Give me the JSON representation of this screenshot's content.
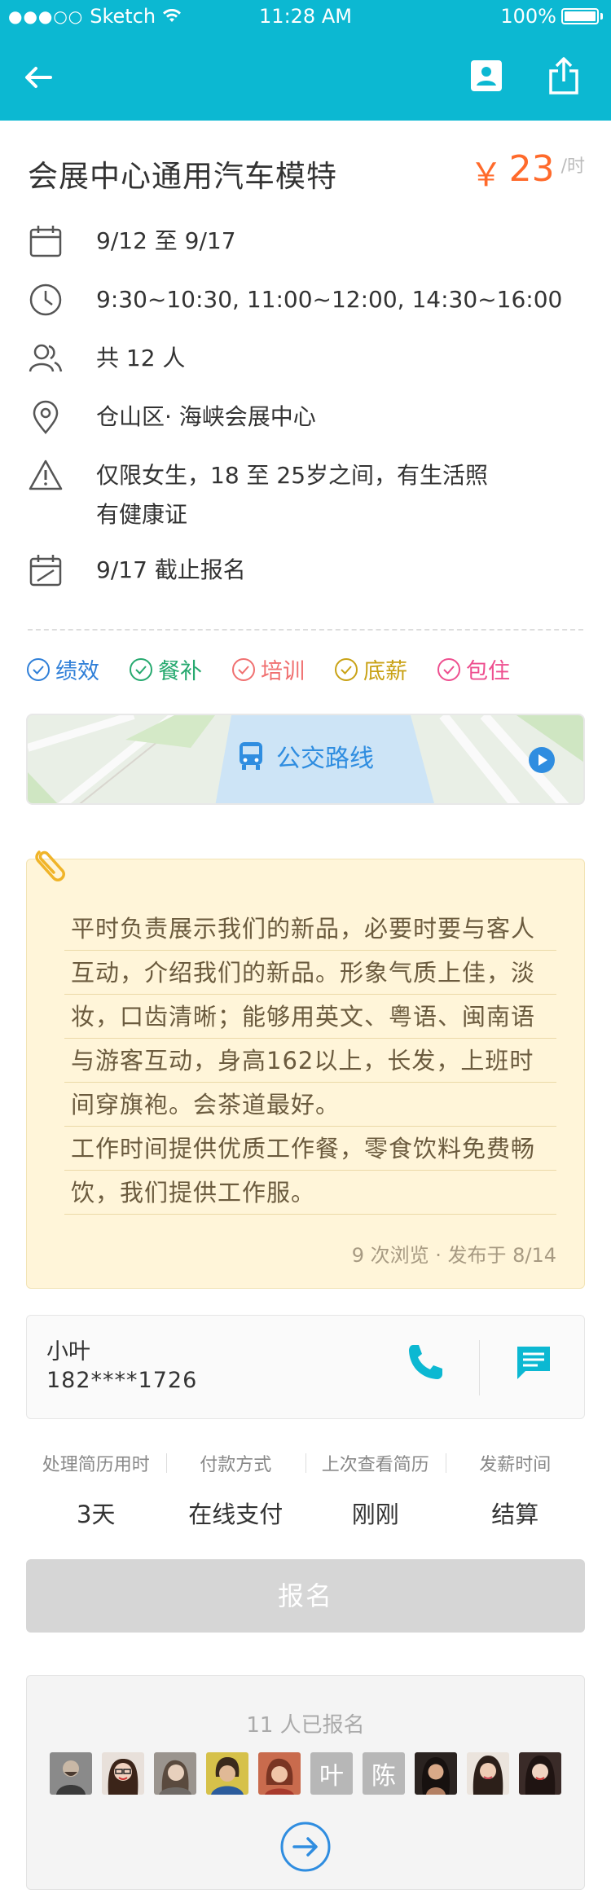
{
  "status_bar": {
    "carrier": "Sketch",
    "signal": "●●●○○",
    "time": "11:28 AM",
    "battery": "100%"
  },
  "header": {
    "icons": [
      "back-arrow-icon",
      "contact-card-icon",
      "share-icon"
    ]
  },
  "job": {
    "title": "会展中心通用汽车模特",
    "price_symbol": "￥",
    "price": "23",
    "price_unit": "/时"
  },
  "info": {
    "date": "9/12 至 9/17",
    "time": "9:30~10:30, 11:00~12:00, 14:30~16:00",
    "people": "共 12 人",
    "location": "仓山区· 海峡会展中心",
    "requirement_line1": "仅限女生，18 至 25岁之间，有生活照",
    "requirement_line2": "有健康证",
    "deadline": "9/17 截止报名"
  },
  "tags": [
    {
      "label": "绩效",
      "color": "#2f7fd8"
    },
    {
      "label": "餐补",
      "color": "#26a96f"
    },
    {
      "label": "培训",
      "color": "#f07070"
    },
    {
      "label": "底薪",
      "color": "#c9a215"
    },
    {
      "label": "包住",
      "color": "#ee4f8f"
    }
  ],
  "map": {
    "label": "公交路线"
  },
  "note": {
    "lines": [
      "平时负责展示我们的新品，必要时要与客人",
      "互动，介绍我们的新品。形象气质上佳，淡",
      "妆，口齿清晰；能够用英文、粤语、闽南语",
      "与游客互动，身高162以上，长发，上班时",
      "间穿旗袍。会茶道最好。",
      "工作时间提供优质工作餐，零食饮料免费畅",
      "饮，我们提供工作服。"
    ],
    "meta": "9 次浏览 · 发布于 8/14"
  },
  "contact": {
    "name": "小叶",
    "phone": "182****1726"
  },
  "stats": [
    {
      "label": "处理简历用时",
      "value": "3天"
    },
    {
      "label": "付款方式",
      "value": "在线支付"
    },
    {
      "label": "上次查看简历",
      "value": "刚刚"
    },
    {
      "label": "发薪时间",
      "value": "结算"
    }
  ],
  "signup_label": "报名",
  "applicants": {
    "count_text": "11 人已报名",
    "text_avatars": [
      "叶",
      "陈"
    ]
  },
  "colors": {
    "primary": "#0cb8d2",
    "price": "#ff6a2b",
    "link": "#2f8de0"
  }
}
